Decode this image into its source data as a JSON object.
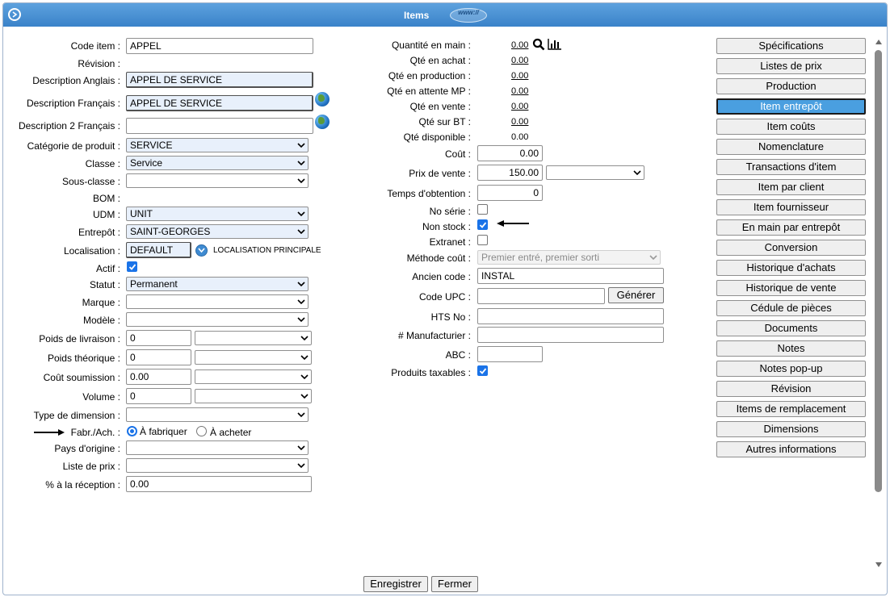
{
  "window": {
    "title": "Items",
    "web_badge": "www://"
  },
  "left": {
    "code_item": {
      "label": "Code item :",
      "value": "APPEL"
    },
    "revision": {
      "label": "Révision :"
    },
    "desc_en": {
      "label": "Description Anglais :",
      "value": "APPEL DE SERVICE"
    },
    "desc_fr": {
      "label": "Description Français :",
      "value": "APPEL DE SERVICE"
    },
    "desc2_fr": {
      "label": "Description 2 Français :",
      "value": ""
    },
    "categorie": {
      "label": "Catégorie de produit :",
      "value": "SERVICE"
    },
    "classe": {
      "label": "Classe :",
      "value": "Service"
    },
    "sous_classe": {
      "label": "Sous-classe :",
      "value": ""
    },
    "bom": {
      "label": "BOM :"
    },
    "udm": {
      "label": "UDM :",
      "value": "UNIT"
    },
    "entrepot": {
      "label": "Entrepôt :",
      "value": "SAINT-GEORGES"
    },
    "localisation": {
      "label": "Localisation :",
      "value": "DEFAULT",
      "note": "LOCALISATION PRINCIPALE"
    },
    "actif": {
      "label": "Actif :",
      "checked": true
    },
    "statut": {
      "label": "Statut :",
      "value": "Permanent"
    },
    "marque": {
      "label": "Marque :",
      "value": ""
    },
    "modele": {
      "label": "Modèle :",
      "value": ""
    },
    "poids_livraison": {
      "label": "Poids de livraison :",
      "value": "0",
      "unit": ""
    },
    "poids_theorique": {
      "label": "Poids théorique :",
      "value": "0",
      "unit": ""
    },
    "cout_soumission": {
      "label": "Coût soumission :",
      "value": "0.00",
      "unit": ""
    },
    "volume": {
      "label": "Volume :",
      "value": "0",
      "unit": ""
    },
    "type_dimension": {
      "label": "Type de dimension :",
      "value": ""
    },
    "fabr_ach": {
      "label": "Fabr./Ach. :",
      "option1": "À fabriquer",
      "option2": "À acheter",
      "selected": "À fabriquer"
    },
    "pays_origine": {
      "label": "Pays d'origine :",
      "value": ""
    },
    "liste_prix": {
      "label": "Liste de prix :",
      "value": ""
    },
    "pct_reception": {
      "label": "% à la réception :",
      "value": "0.00"
    }
  },
  "middle": {
    "qte_main": {
      "label": "Quantité en main :",
      "value": "0.00"
    },
    "qte_achat": {
      "label": "Qté en achat :",
      "value": "0.00"
    },
    "qte_production": {
      "label": "Qté en production :",
      "value": "0.00"
    },
    "qte_attente_mp": {
      "label": "Qté en attente MP :",
      "value": "0.00"
    },
    "qte_vente": {
      "label": "Qté en vente :",
      "value": "0.00"
    },
    "qte_bt": {
      "label": "Qté sur BT :",
      "value": "0.00"
    },
    "qte_disponible": {
      "label": "Qté disponible :",
      "value": "0.00"
    },
    "cout": {
      "label": "Coût :",
      "value": "0.00"
    },
    "prix_vente": {
      "label": "Prix de vente :",
      "value": "150.00",
      "currency": ""
    },
    "temps_obtention": {
      "label": "Temps d'obtention :",
      "value": "0"
    },
    "no_serie": {
      "label": "No série :",
      "checked": false
    },
    "non_stock": {
      "label": "Non stock :",
      "checked": true
    },
    "extranet": {
      "label": "Extranet :",
      "checked": false
    },
    "methode_cout": {
      "label": "Méthode coût :",
      "value": "Premier entré, premier sorti"
    },
    "ancien_code": {
      "label": "Ancien code :",
      "value": "INSTAL"
    },
    "code_upc": {
      "label": "Code UPC :",
      "value": "",
      "button": "Générer"
    },
    "hts_no": {
      "label": "HTS No :",
      "value": ""
    },
    "manufacturier": {
      "label": "# Manufacturier :",
      "value": ""
    },
    "abc": {
      "label": "ABC :",
      "value": ""
    },
    "produits_taxables": {
      "label": "Produits taxables :",
      "checked": true
    }
  },
  "sidebar": {
    "items": [
      {
        "label": "Spécifications",
        "active": false
      },
      {
        "label": "Listes de prix",
        "active": false
      },
      {
        "label": "Production",
        "active": false
      },
      {
        "label": "Item entrepôt",
        "active": true
      },
      {
        "label": "Item coûts",
        "active": false
      },
      {
        "label": "Nomenclature",
        "active": false
      },
      {
        "label": "Transactions d'item",
        "active": false
      },
      {
        "label": "Item par client",
        "active": false
      },
      {
        "label": "Item fournisseur",
        "active": false
      },
      {
        "label": "En main par entrepôt",
        "active": false
      },
      {
        "label": "Conversion",
        "active": false
      },
      {
        "label": "Historique d'achats",
        "active": false
      },
      {
        "label": "Historique de vente",
        "active": false
      },
      {
        "label": "Cédule de pièces",
        "active": false
      },
      {
        "label": "Documents",
        "active": false
      },
      {
        "label": "Notes",
        "active": false
      },
      {
        "label": "Notes pop-up",
        "active": false
      },
      {
        "label": "Révision",
        "active": false
      },
      {
        "label": "Items de remplacement",
        "active": false
      },
      {
        "label": "Dimensions",
        "active": false
      },
      {
        "label": "Autres informations",
        "active": false
      }
    ]
  },
  "footer": {
    "save": "Enregistrer",
    "close": "Fermer"
  },
  "colors": {
    "titlebar": "#3a82c9",
    "active_tab": "#4a9fe0",
    "field_highlight": "#e8f0fb",
    "checkbox": "#1a73e8"
  }
}
